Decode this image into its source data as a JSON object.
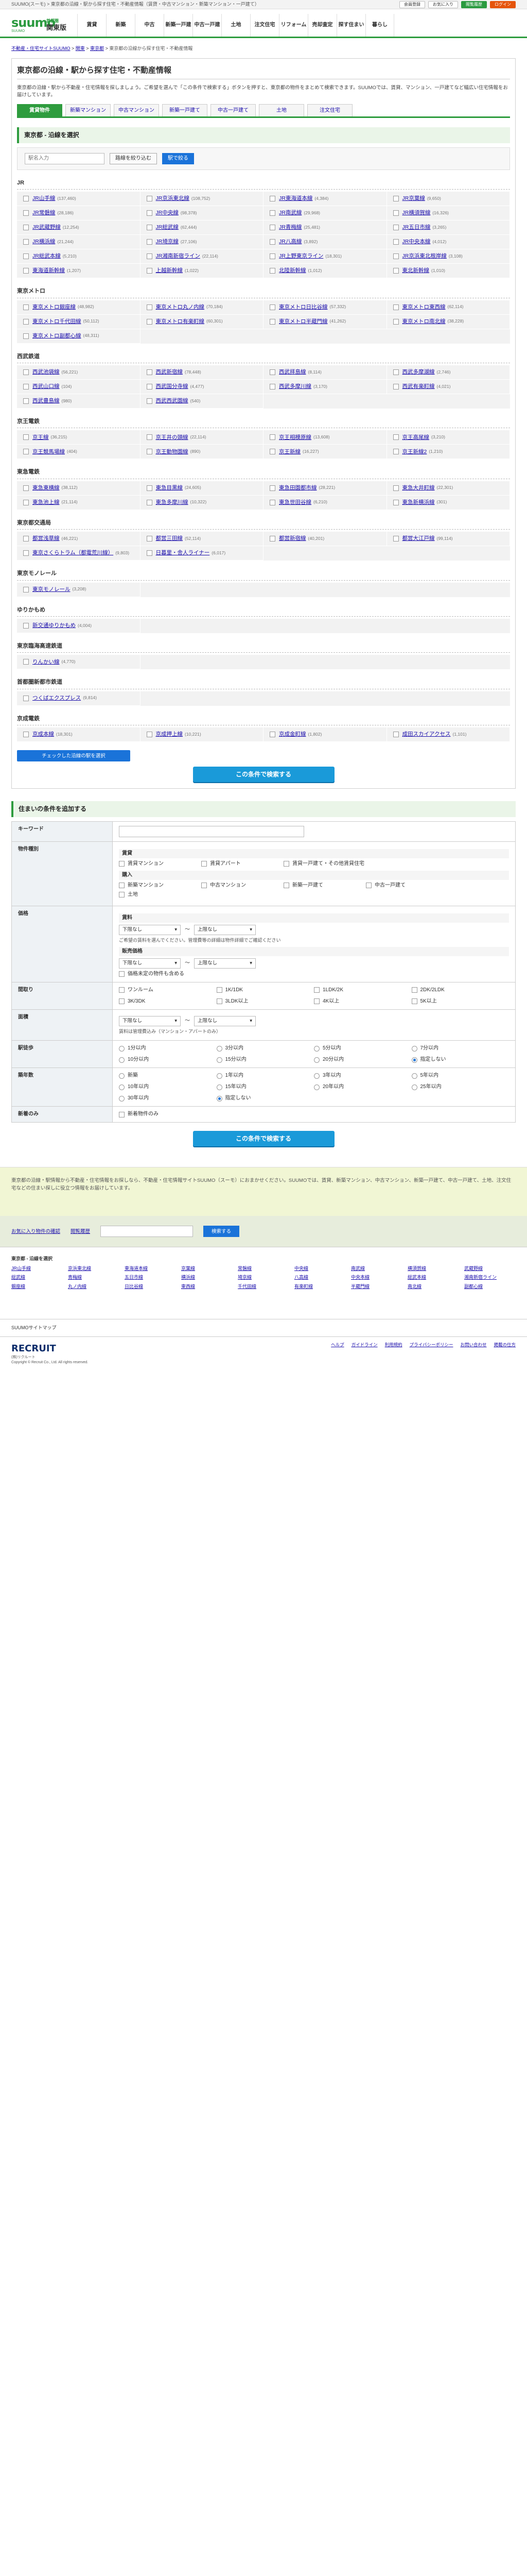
{
  "top": {
    "text": "SUUMO(スーモ) > 東京都の沿線・駅から探す住宅・不動産情報（賃貸・中古マンション・新築マンション・一戸建て）",
    "buttons": [
      "会員登録",
      "お気に入り",
      "閲覧履歴",
      "ログイン"
    ]
  },
  "header": {
    "logo": "suumo",
    "tagline": "SUUMO",
    "area": "関東版",
    "area_sub": "首都圏",
    "nav": [
      "賃貸",
      "新築",
      "中古",
      "新築一戸建",
      "中古一戸建",
      "土地",
      "注文住宅",
      "リフォーム",
      "売却査定",
      "探す住まい",
      "暮らし"
    ]
  },
  "crumbs": [
    "不動産・住宅サイトSUUMO",
    "関東",
    "東京都",
    "東京都の沿線から探す住宅・不動産情報"
  ],
  "title": "東京都の沿線・駅から探す住宅・不動産情報",
  "lead": "東京都の沿線・駅から不動産・住宅情報を探しましょう。ご希望を選んで「この条件で検索する」ボタンを押すと、東京都の物件をまとめて検索できます。SUUMOでは、賃貸、マンション、一戸建てなど幅広い住宅情報をお届けしています。",
  "tabs": [
    "賃貸物件",
    "新築マンション",
    "中古マンション",
    "新築一戸建て",
    "中古一戸建て",
    "土地",
    "注文住宅",
    "リフォーム"
  ],
  "section_title": "東京都 ‐ 沿線を選択",
  "search": {
    "placeholder": "駅名入力",
    "btn1": "路線を絞り込む",
    "btn2": "駅で絞る"
  },
  "companies": [
    {
      "name": "JR",
      "lines": [
        [
          "JR山手線",
          "(137,460)"
        ],
        [
          "JR京浜東北線",
          "(108,752)"
        ],
        [
          "JR東海道本線",
          "(4,384)"
        ],
        [
          "JR京葉線",
          "(9,650)"
        ],
        [
          "JR常磐線",
          "(28,186)"
        ],
        [
          "JR中央線",
          "(98,378)"
        ],
        [
          "JR南武線",
          "(29,968)"
        ],
        [
          "JR横須賀線",
          "(16,326)"
        ],
        [
          "JR武蔵野線",
          "(12,254)"
        ],
        [
          "JR総武線",
          "(62,444)"
        ],
        [
          "JR青梅線",
          "(25,481)"
        ],
        [
          "JR五日市線",
          "(3,265)"
        ],
        [
          "JR横浜線",
          "(21,244)"
        ],
        [
          "JR埼京線",
          "(27,106)"
        ],
        [
          "JR八高線",
          "(3,892)"
        ],
        [
          "JR中央本線",
          "(4,012)"
        ],
        [
          "JR総武本線",
          "(5,210)"
        ],
        [
          "JR湘南新宿ライン",
          "(22,114)"
        ],
        [
          "JR上野東京ライン",
          "(18,301)"
        ],
        [
          "JR京浜東北根岸線",
          "(3,108)"
        ],
        [
          "東海道新幹線",
          "(1,207)"
        ],
        [
          "上越新幹線",
          "(1,022)"
        ],
        [
          "北陸新幹線",
          "(1,012)"
        ],
        [
          "東北新幹線",
          "(1,010)"
        ]
      ]
    },
    {
      "name": "東京メトロ",
      "lines": [
        [
          "東京メトロ銀座線",
          "(48,982)"
        ],
        [
          "東京メトロ丸ノ内線",
          "(70,184)"
        ],
        [
          "東京メトロ日比谷線",
          "(57,332)"
        ],
        [
          "東京メトロ東西線",
          "(62,114)"
        ],
        [
          "東京メトロ千代田線",
          "(50,112)"
        ],
        [
          "東京メトロ有楽町線",
          "(60,301)"
        ],
        [
          "東京メトロ半蔵門線",
          "(41,262)"
        ],
        [
          "東京メトロ南北線",
          "(38,228)"
        ],
        [
          "東京メトロ副都心線",
          "(48,311)"
        ]
      ]
    },
    {
      "name": "西武鉄道",
      "lines": [
        [
          "西武池袋線",
          "(56,221)"
        ],
        [
          "西武新宿線",
          "(78,448)"
        ],
        [
          "西武拝島線",
          "(8,114)"
        ],
        [
          "西武多摩湖線",
          "(2,746)"
        ],
        [
          "西武山口線",
          "(104)"
        ],
        [
          "西武国分寺線",
          "(4,477)"
        ],
        [
          "西武多摩川線",
          "(3,170)"
        ],
        [
          "西武有楽町線",
          "(4,021)"
        ],
        [
          "西武豊島線",
          "(980)"
        ],
        [
          "西武西武園線",
          "(540)"
        ]
      ]
    },
    {
      "name": "京王電鉄",
      "lines": [
        [
          "京王線",
          "(36,215)"
        ],
        [
          "京王井の頭線",
          "(22,114)"
        ],
        [
          "京王相模原線",
          "(13,608)"
        ],
        [
          "京王高尾線",
          "(3,210)"
        ],
        [
          "京王競馬場線",
          "(404)"
        ],
        [
          "京王動物園線",
          "(890)"
        ],
        [
          "京王新線",
          "(16,227)"
        ],
        [
          "京王新線2",
          "(1,210)"
        ]
      ]
    },
    {
      "name": "東急電鉄",
      "lines": [
        [
          "東急東横線",
          "(38,112)"
        ],
        [
          "東急目黒線",
          "(24,605)"
        ],
        [
          "東急田園都市線",
          "(28,221)"
        ],
        [
          "東急大井町線",
          "(22,301)"
        ],
        [
          "東急池上線",
          "(21,114)"
        ],
        [
          "東急多摩川線",
          "(10,322)"
        ],
        [
          "東急世田谷線",
          "(6,210)"
        ],
        [
          "東急新横浜線",
          "(301)"
        ]
      ]
    },
    {
      "name": "東京都交通局",
      "lines": [
        [
          "都営浅草線",
          "(46,221)"
        ],
        [
          "都営三田線",
          "(52,114)"
        ],
        [
          "都営新宿線",
          "(40,201)"
        ],
        [
          "都営大江戸線",
          "(99,114)"
        ],
        [
          "東京さくらトラム（都電荒川線）",
          "(9,803)"
        ],
        [
          "日暮里・舎人ライナー",
          "(6,017)"
        ]
      ]
    },
    {
      "name": "東京モノレール",
      "lines": [
        [
          "東京モノレール",
          "(3,208)"
        ]
      ]
    },
    {
      "name": "ゆりかもめ",
      "lines": [
        [
          "新交通ゆりかもめ",
          "(4,004)"
        ]
      ]
    },
    {
      "name": "東京臨海高速鉄道",
      "lines": [
        [
          "りんかい線",
          "(4,770)"
        ]
      ]
    },
    {
      "name": "首都圏新都市鉄道",
      "lines": [
        [
          "つくばエクスプレス",
          "(9,814)"
        ]
      ]
    },
    {
      "name": "京成電鉄",
      "lines": [
        [
          "京成本線",
          "(18,301)"
        ],
        [
          "京成押上線",
          "(10,221)"
        ],
        [
          "京成金町線",
          "(1,802)"
        ],
        [
          "成田スカイアクセス",
          "(1,101)"
        ]
      ]
    }
  ],
  "line_btn": "チェックした沿線の駅を選択",
  "search_btn": "この条件で検索する",
  "cond": {
    "title": "住まいの条件を追加する",
    "rows": {
      "keyword": "キーワード",
      "type": "物件種別",
      "price": "価格",
      "madori": "間取り",
      "menseki": "面積",
      "walk": "駅徒歩",
      "age": "築年数",
      "other": "新着のみ"
    }
  },
  "types": {
    "rent": "賃貸",
    "rent_opts": [
      "賃貸マンション",
      "賃貸アパート",
      "賃貸一戸建て・その他賃貸住宅"
    ],
    "buy": "購入",
    "buy_opts": [
      "新築マンション",
      "中古マンション",
      "新築一戸建て",
      "中古一戸建て",
      "土地"
    ]
  },
  "price": {
    "rent": "賃料",
    "from": "下限なし",
    "to": "上限なし",
    "note": "ご希望の賃料を選んでください。管理費等の詳細は物件詳細でご確認ください",
    "buy": "販売価格",
    "check": "価格未定の物件も含める"
  },
  "madori": [
    "ワンルーム",
    "1K/1DK",
    "1LDK/2K",
    "2DK/2LDK",
    "3K/3DK",
    "3LDK以上",
    "4K以上",
    "5K以上"
  ],
  "menseki": {
    "from": "下限なし",
    "to": "上限なし",
    "note": "賃料は管理費込み（マンション・アパートのみ）"
  },
  "walk": [
    "1分以内",
    "3分以内",
    "5分以内",
    "7分以内",
    "10分以内",
    "15分以内",
    "20分以内",
    "指定しない"
  ],
  "age": [
    "新築",
    "1年以内",
    "3年以内",
    "5年以内",
    "10年以内",
    "15年以内",
    "20年以内",
    "25年以内",
    "30年以内",
    "指定しない"
  ],
  "new": "新着物件のみ",
  "footer": {
    "about": "東京都の沿線・駅情報から不動産・住宅情報をお探しなら、不動産・住宅情報サイトSUUMO（スーモ）におまかせください。SUUMOでは、賃貸、新築マンション、中古マンション、新築一戸建て、中古一戸建て、土地、注文住宅などの住まい探しに役立つ情報をお届けしています。",
    "search_label": "お気に入り物件の確認",
    "search_label2": "閲覧履歴",
    "search_btn": "検索する",
    "links_title": "東京都 ‐ 沿線を選択",
    "links": [
      "JR山手線",
      "京浜東北線",
      "東海道本線",
      "京葉線",
      "常磐線",
      "中央線",
      "南武線",
      "横須賀線",
      "武蔵野線",
      "総武線",
      "青梅線",
      "五日市線",
      "横浜線",
      "埼京線",
      "八高線",
      "中央本線",
      "総武本線",
      "湘南新宿ライン",
      "銀座線",
      "丸ノ内線",
      "日比谷線",
      "東西線",
      "千代田線",
      "有楽町線",
      "半蔵門線",
      "南北線",
      "副都心線"
    ],
    "sitemap": "SUUMOサイトマップ",
    "company": "Copyright © Recruit Co., Ltd. All rights reserved.",
    "rec": "RECRUIT",
    "rec_sub": "(株)リクルート",
    "flinks": [
      "ヘルプ",
      "ガイドライン",
      "利用規約",
      "プライバシーポリシー",
      "お問い合わせ",
      "掲載の仕方"
    ]
  }
}
